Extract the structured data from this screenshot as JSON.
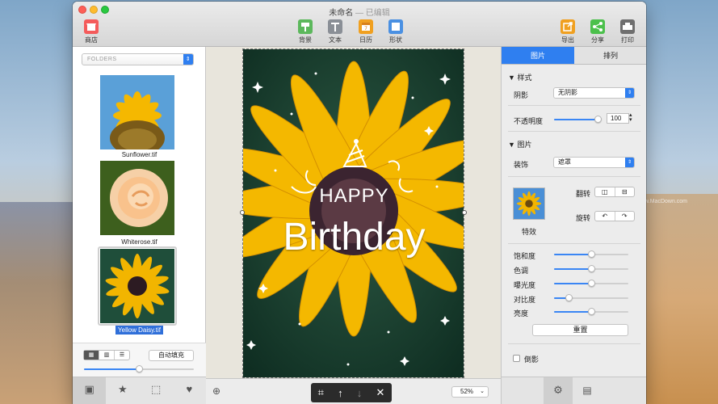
{
  "window": {
    "title": "未命名",
    "subtitle": "— 已编辑"
  },
  "toolbar": {
    "store": "商店",
    "background": "背景",
    "text": "文本",
    "calendar": "日历",
    "shape": "形状",
    "export": "导出",
    "share": "分享",
    "print": "打印"
  },
  "sidebar": {
    "folders_label": "FOLDERS",
    "images": [
      {
        "label": "Sunflower.tif",
        "selected": false
      },
      {
        "label": "Whiterose.tif",
        "selected": false
      },
      {
        "label": "Yellow Daisy.tif",
        "selected": true
      }
    ],
    "view_modes": [
      "▦",
      "▥",
      "☰"
    ],
    "auto_fill": "自动填充",
    "thumb_size": 0.5
  },
  "canvas": {
    "happy": "HAPPY",
    "birthday": "Birthday",
    "zoom": "52%"
  },
  "inspector": {
    "tabs": [
      "图片",
      "排列"
    ],
    "style_section": "样式",
    "shadow_label": "阴影",
    "shadow_value": "无阴影",
    "opacity_label": "不透明度",
    "opacity_value": "100",
    "opacity_level": 1.0,
    "image_section": "图片",
    "decoration_label": "装饰",
    "decoration_value": "遮罩",
    "flip_label": "翻转",
    "rotate_label": "旋转",
    "effects_label": "特效",
    "adjustments": [
      {
        "label": "饱和度",
        "level": 0.5
      },
      {
        "label": "色调",
        "level": 0.5
      },
      {
        "label": "曝光度",
        "level": 0.5
      },
      {
        "label": "对比度",
        "level": 0.2
      },
      {
        "label": "亮度",
        "level": 0.5
      }
    ],
    "reset": "重置",
    "reflection": "倒影"
  },
  "watermark": "www.MacDown.com",
  "colors": {
    "accent": "#2f7ff0",
    "store_icon": "#f45b5b",
    "background_icon": "#5cb85c",
    "text_icon": "#8a8f96",
    "calendar_icon": "#f0a020",
    "shape_icon": "#4a90e2",
    "export_icon": "#f0a020",
    "share_icon": "#4cc04c",
    "print_icon": "#6f6f6f"
  }
}
